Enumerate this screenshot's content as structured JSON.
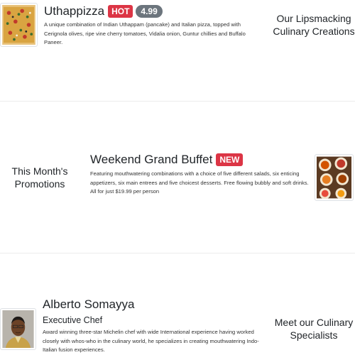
{
  "dishes": {
    "heading": "Our Lipsmacking Culinary Creations",
    "item": {
      "name": "Uthappizza",
      "label": "HOT",
      "price": "4.99",
      "description": "A unique combination of Indian Uthappam (pancake) and Italian pizza, topped with Cerignola olives, ripe vine cherry tomatoes, Vidalia onion, Guntur chillies and Buffalo Paneer.",
      "image": "pizza-photo"
    }
  },
  "promotions": {
    "heading": "This Month's Promotions",
    "item": {
      "name": "Weekend Grand Buffet",
      "label": "NEW",
      "description": "Featuring mouthwatering combinations with a choice of five different salads, six enticing appetizers, six main entrees and five choicest desserts. Free flowing bubbly and soft drinks. All for just $19.99 per person",
      "image": "buffet-photo"
    }
  },
  "chefs": {
    "heading": "Meet our Culinary Specialists",
    "item": {
      "name": "Alberto Somayya",
      "designation": "Executive Chef",
      "description": "Award winning three-star Michelin chef with wide International experience having worked closely with whos-who in the culinary world, he specializes in creating mouthwatering Indo-Italian fusion experiences.",
      "image": "chef-photo"
    }
  },
  "colors": {
    "badge_red": "#dc3545",
    "badge_gray": "#6c757d"
  }
}
